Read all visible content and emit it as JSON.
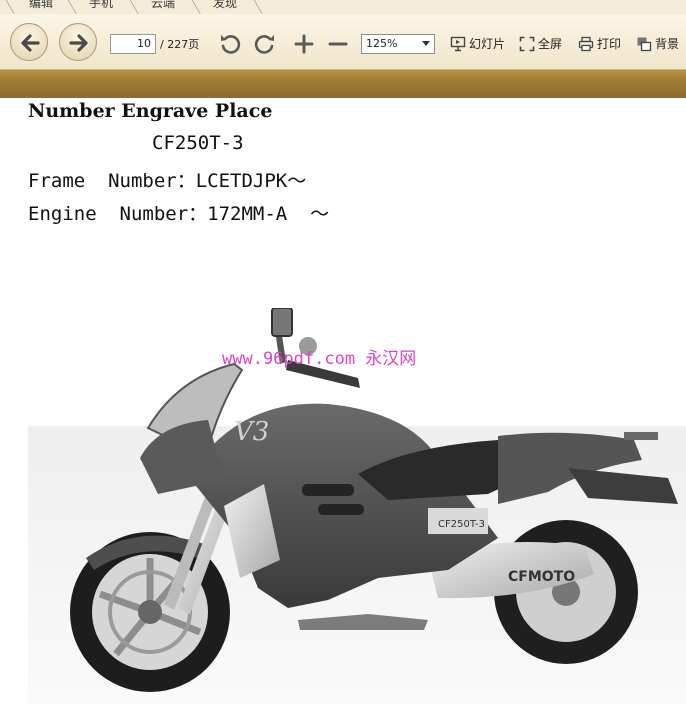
{
  "tabs": [
    {
      "label": "编辑"
    },
    {
      "label": "手机"
    },
    {
      "label": "云端"
    },
    {
      "label": "发现"
    }
  ],
  "toolbar": {
    "current_page": "10",
    "page_total": "/ 227页",
    "zoom": "125%",
    "slideshow_label": "幻灯片",
    "fullscreen_label": "全屏",
    "print_label": "打印",
    "background_label": "背景"
  },
  "document": {
    "heading": "Number Engrave Place",
    "model": "CF250T-3",
    "frame_line": "Frame  Number：LCETDJPK～",
    "engine_line": "Engine  Number：172MM-A  ～",
    "watermark": "www.96pdf.com 永汉网",
    "photo": {
      "brand_text": "CFMOTO",
      "model_decal": "CF250T-3",
      "fairing_logo": "V3",
      "colors": {
        "body": "#4d4d4d",
        "seat": "#2a2a2a",
        "chrome": "#c9c9c9"
      }
    }
  },
  "colors": {
    "toolbar_bg": "#f4ecd9",
    "band": "#a37e36",
    "watermark": "#d946c9"
  }
}
